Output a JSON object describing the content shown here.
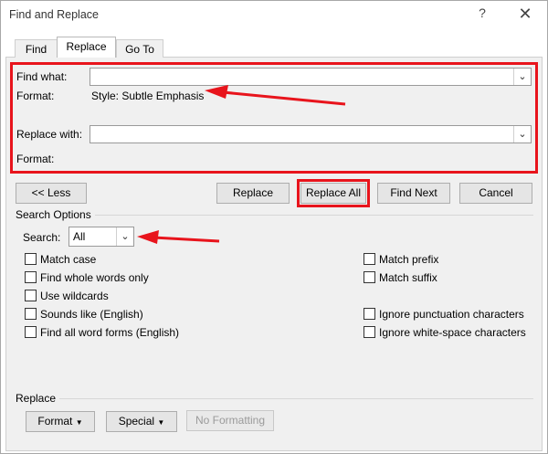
{
  "window": {
    "title": "Find and Replace",
    "help_label": "?",
    "close_label": "✕"
  },
  "tabs": [
    {
      "label": "Find",
      "active": false
    },
    {
      "label": "Replace",
      "active": true
    },
    {
      "label": "Go To",
      "active": false
    }
  ],
  "find": {
    "label": "Find what:",
    "value": "",
    "format_label": "Format:",
    "format_value": "Style: Subtle Emphasis"
  },
  "replace": {
    "label": "Replace with:",
    "value": "",
    "format_label": "Format:",
    "format_value": ""
  },
  "buttons": {
    "less": "<< Less",
    "replace": "Replace",
    "replace_all": "Replace All",
    "find_next": "Find Next",
    "cancel": "Cancel"
  },
  "search_options": {
    "heading": "Search Options",
    "search_label": "Search:",
    "search_value": "All",
    "left_options": [
      {
        "label": "Match case",
        "checked": false
      },
      {
        "label": "Find whole words only",
        "checked": false
      },
      {
        "label": "Use wildcards",
        "checked": false
      },
      {
        "label": "Sounds like (English)",
        "checked": false
      },
      {
        "label": "Find all word forms (English)",
        "checked": false
      }
    ],
    "right_options": [
      {
        "label": "Match prefix",
        "checked": false
      },
      {
        "label": "Match suffix",
        "checked": false
      },
      {
        "label": "Ignore punctuation characters",
        "checked": false
      },
      {
        "label": "Ignore white-space characters",
        "checked": false
      }
    ]
  },
  "replace_section": {
    "heading": "Replace",
    "format_button": "Format",
    "special_button": "Special",
    "no_formatting_button": "No Formatting"
  },
  "colors": {
    "highlight": "#e8141c",
    "dialog_bg": "#f0f0f0"
  }
}
